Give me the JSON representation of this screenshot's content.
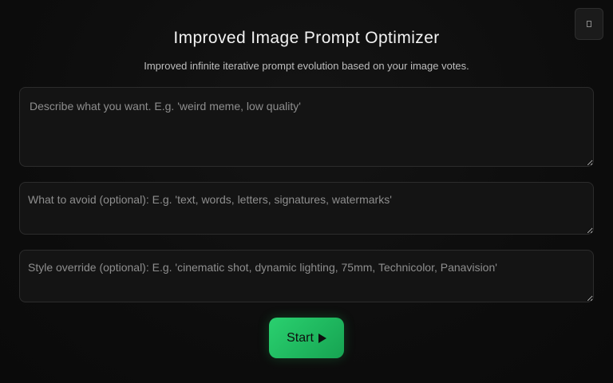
{
  "header": {
    "title": "Improved Image Prompt Optimizer",
    "subtitle": "Improved infinite iterative prompt evolution based on your image votes."
  },
  "form": {
    "main_placeholder": "Describe what you want. E.g. 'weird meme, low quality'",
    "avoid_placeholder": "What to avoid (optional): E.g. 'text, words, letters, signatures, watermarks'",
    "style_placeholder": "Style override (optional): E.g. 'cinematic shot, dynamic lighting, 75mm, Technicolor, Panavision'"
  },
  "actions": {
    "start_label": "Start",
    "start_icon": "play-icon",
    "corner_icon": "menu-icon"
  },
  "colors": {
    "background": "#0d0d0d",
    "accent": "#22c55e",
    "field_bg": "#141414",
    "field_border": "#2c2c2c"
  }
}
